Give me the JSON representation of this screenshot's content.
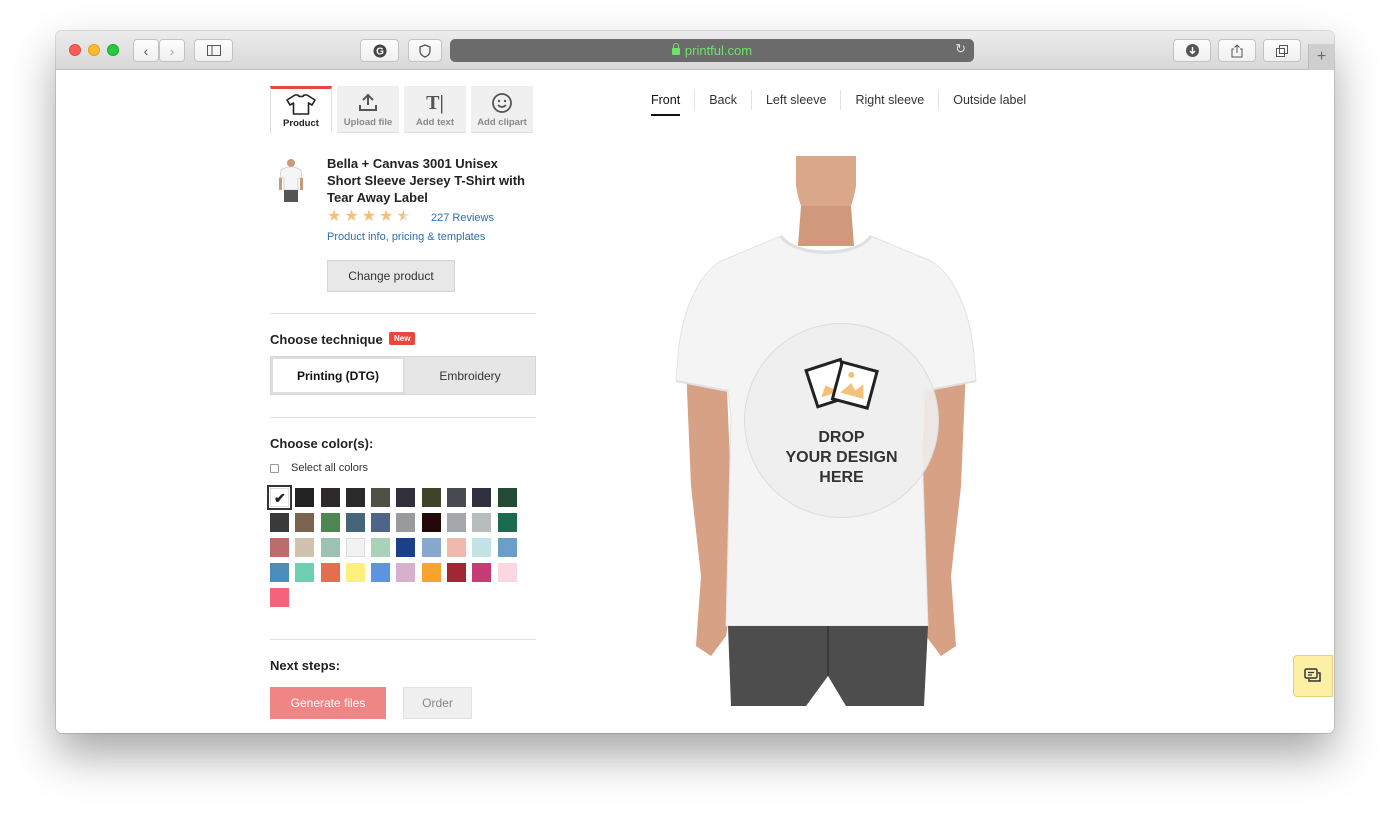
{
  "browser": {
    "url": "printful.com"
  },
  "tools": [
    {
      "label": "Product",
      "icon": "tshirt-icon"
    },
    {
      "label": "Upload file",
      "icon": "upload-icon"
    },
    {
      "label": "Add text",
      "icon": "text-icon"
    },
    {
      "label": "Add clipart",
      "icon": "smiley-icon"
    }
  ],
  "product": {
    "title": "Bella + Canvas 3001 Unisex Short Sleeve Jersey T-Shirt with Tear Away Label",
    "rating": 4.5,
    "reviews_label": "227 Reviews",
    "info_link": "Product info, pricing & templates",
    "change_button": "Change product"
  },
  "technique": {
    "title": "Choose technique",
    "badge": "New",
    "options": [
      "Printing (DTG)",
      "Embroidery"
    ],
    "selected": "Printing (DTG)"
  },
  "colors": {
    "title": "Choose color(s):",
    "select_all_label": "Select all colors",
    "swatches": [
      "#ffffff",
      "#222222",
      "#2e2a2b",
      "#2a2a2a",
      "#4f5144",
      "#30303a",
      "#3e4429",
      "#484b50",
      "#2f3140",
      "#234b33",
      "#3a3a3a",
      "#7b634e",
      "#4f8753",
      "#46647a",
      "#4d6586",
      "#999a9c",
      "#250909",
      "#a3a6aa",
      "#b9bcbd",
      "#1b6b50",
      "#bd6b6b",
      "#d0c2ac",
      "#9dc2b3",
      "#f2f2f2",
      "#a8d3b8",
      "#1b3f88",
      "#88a9ce",
      "#f0b9ae",
      "#c3e2e5",
      "#6b9fc7",
      "#4b8cbd",
      "#6ed0b0",
      "#e56e4f",
      "#fdf17c",
      "#5c94e0",
      "#d6b0cd",
      "#f7a42e",
      "#a22733",
      "#c73c75",
      "#fbd7e2",
      "#f5627a"
    ],
    "selected_index": 0
  },
  "next_steps": {
    "title": "Next steps:",
    "generate_label": "Generate files",
    "order_label": "Order"
  },
  "views": {
    "tabs": [
      "Front",
      "Back",
      "Left sleeve",
      "Right sleeve",
      "Outside label"
    ],
    "active": "Front"
  },
  "drop_zone": {
    "line1": "DROP",
    "line2": "YOUR DESIGN",
    "line3": "HERE"
  }
}
